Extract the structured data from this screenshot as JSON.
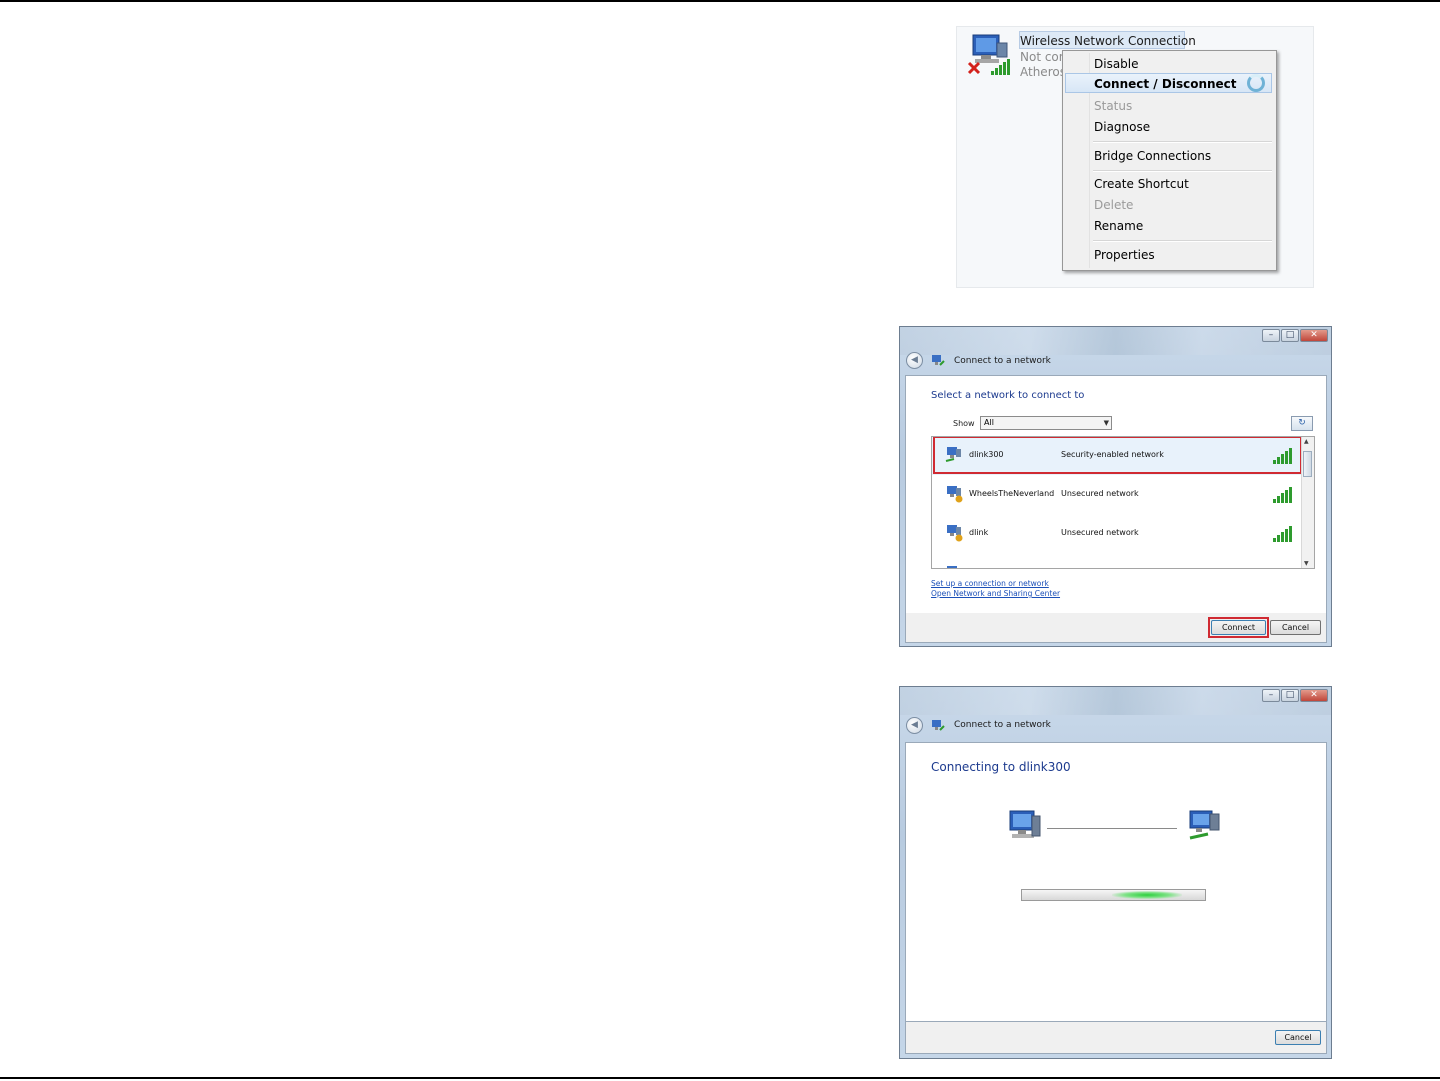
{
  "panel1": {
    "connection": {
      "title": "Wireless Network Connection",
      "status": "Not con",
      "adapter": "Atheros"
    },
    "menu": {
      "items": [
        {
          "label": "Disable",
          "enabled": true
        },
        {
          "label": "Connect / Disconnect",
          "enabled": true,
          "bold": true,
          "highlighted": true
        },
        {
          "label": "Status",
          "enabled": false
        },
        {
          "label": "Diagnose",
          "enabled": true
        },
        {
          "label": "Bridge Connections",
          "enabled": true
        },
        {
          "label": "Create Shortcut",
          "enabled": true
        },
        {
          "label": "Delete",
          "enabled": false
        },
        {
          "label": "Rename",
          "enabled": true
        },
        {
          "label": "Properties",
          "enabled": true
        }
      ]
    }
  },
  "panel2": {
    "window_title": "Connect to a network",
    "heading": "Select a network to connect to",
    "show_label": "Show",
    "show_value": "All",
    "networks": [
      {
        "name": "dlink300",
        "security": "Security-enabled network",
        "selected": true
      },
      {
        "name": "WheelsTheNeverland",
        "security": "Unsecured network",
        "selected": false
      },
      {
        "name": "dlink",
        "security": "Unsecured network",
        "selected": false
      }
    ],
    "links": {
      "setup": "Set up a connection or network",
      "open_center": "Open Network and Sharing Center"
    },
    "buttons": {
      "connect": "Connect",
      "cancel": "Cancel"
    }
  },
  "panel3": {
    "window_title": "Connect to a network",
    "heading": "Connecting to dlink300",
    "buttons": {
      "cancel": "Cancel"
    }
  },
  "colors": {
    "highlight_red": "#d02a32",
    "heading_blue": "#1c3a8e",
    "link_blue": "#1c50b8",
    "progress_green": "#2ccf3e"
  }
}
